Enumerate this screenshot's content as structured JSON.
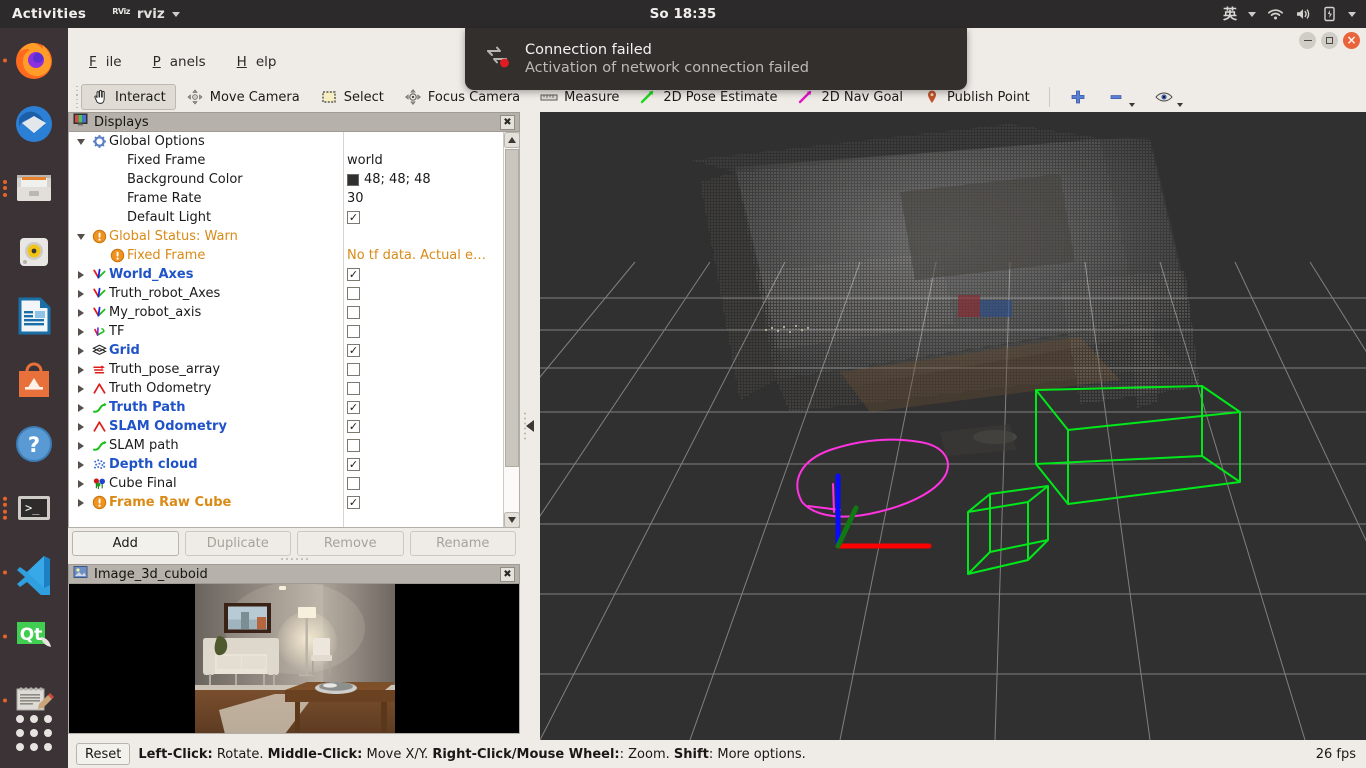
{
  "topbar": {
    "activities": "Activities",
    "app_name": "rviz",
    "app_icon": "rviz-icon",
    "clock": "So 18:35",
    "ime": "英",
    "tray_icons": [
      "wifi-icon",
      "volume-icon",
      "battery-icon"
    ]
  },
  "dock": {
    "items": [
      {
        "name": "firefox",
        "label": "Firefox",
        "running": true
      },
      {
        "name": "thunderbird",
        "label": "Thunderbird",
        "running": false
      },
      {
        "name": "files",
        "label": "Files",
        "running": true
      },
      {
        "name": "rhythmbox",
        "label": "Rhythmbox",
        "running": false
      },
      {
        "name": "libreoffice-impress",
        "label": "LibreOffice Impress",
        "running": false
      },
      {
        "name": "ubuntu-software",
        "label": "Ubuntu Software",
        "running": false
      },
      {
        "name": "help",
        "label": "Help",
        "running": false
      },
      {
        "name": "terminal",
        "label": "Terminal",
        "running": true
      },
      {
        "name": "vscode",
        "label": "Visual Studio Code",
        "running": true
      },
      {
        "name": "qtcreator",
        "label": "Qt Creator",
        "running": true
      },
      {
        "name": "text-editor",
        "label": "Text Editor",
        "running": true
      }
    ],
    "show_apps": "Show Applications"
  },
  "notification": {
    "icon": "network-error-icon",
    "title": "Connection failed",
    "body": "Activation of network connection failed"
  },
  "window": {
    "minimize": "–",
    "maximize": "□",
    "close": "×"
  },
  "menu": [
    {
      "name": "file",
      "pre": "",
      "key": "F",
      "post": "ile"
    },
    {
      "name": "panels",
      "pre": "",
      "key": "P",
      "post": "anels"
    },
    {
      "name": "help",
      "pre": "",
      "key": "H",
      "post": "elp"
    }
  ],
  "toolbar": {
    "items": [
      {
        "name": "interact",
        "label": "Interact",
        "icon": "hand-cursor-icon",
        "active": true
      },
      {
        "name": "move-camera",
        "label": "Move Camera",
        "icon": "move-camera-icon",
        "active": false
      },
      {
        "name": "select",
        "label": "Select",
        "icon": "select-rect-icon",
        "active": false
      },
      {
        "name": "focus-camera",
        "label": "Focus Camera",
        "icon": "focus-camera-icon",
        "active": false
      },
      {
        "name": "measure",
        "label": "Measure",
        "icon": "ruler-icon",
        "active": false
      },
      {
        "name": "pose-estimate",
        "label": "2D Pose Estimate",
        "icon": "green-arrow-icon",
        "active": false
      },
      {
        "name": "nav-goal",
        "label": "2D Nav Goal",
        "icon": "magenta-arrow-icon",
        "active": false
      },
      {
        "name": "publish-point",
        "label": "Publish Point",
        "icon": "map-pin-icon",
        "active": false
      }
    ],
    "add_tool": "+",
    "remove_tool": "–",
    "visibility": "eye"
  },
  "displays_panel": {
    "title": "Displays",
    "icon": "displays-icon",
    "close": "✖",
    "rows": [
      {
        "name": "global-options",
        "label": "Global Options",
        "indent": 0,
        "arrow": "down",
        "icon": "gear-icon",
        "style": "plain",
        "value_type": "none",
        "value": ""
      },
      {
        "name": "fixed-frame",
        "label": "Fixed Frame",
        "indent": 1,
        "arrow": "none",
        "icon": "none",
        "style": "plain",
        "value_type": "text",
        "value": "world"
      },
      {
        "name": "background-color",
        "label": "Background Color",
        "indent": 1,
        "arrow": "none",
        "icon": "none",
        "style": "plain",
        "value_type": "color",
        "value": "48; 48; 48",
        "color": "#303030"
      },
      {
        "name": "frame-rate",
        "label": "Frame Rate",
        "indent": 1,
        "arrow": "none",
        "icon": "none",
        "style": "plain",
        "value_type": "text",
        "value": "30"
      },
      {
        "name": "default-light",
        "label": "Default Light",
        "indent": 1,
        "arrow": "none",
        "icon": "none",
        "style": "plain",
        "value_type": "check",
        "value": "✓"
      },
      {
        "name": "global-status",
        "label": "Global Status: Warn",
        "indent": 0,
        "arrow": "down",
        "icon": "warning-icon",
        "style": "warn",
        "value_type": "none",
        "value": ""
      },
      {
        "name": "status-fixed-frame",
        "label": "Fixed Frame",
        "indent": 1,
        "arrow": "none",
        "icon": "warning-icon",
        "style": "warn",
        "value_type": "text",
        "value": "No tf data.  Actual e…"
      },
      {
        "name": "world-axes",
        "label": "World_Axes",
        "indent": 0,
        "arrow": "right",
        "icon": "axes-icon",
        "style": "enabled",
        "value_type": "check",
        "value": "✓"
      },
      {
        "name": "truth-robot-axes",
        "label": "Truth_robot_Axes",
        "indent": 0,
        "arrow": "right",
        "icon": "axes-icon",
        "style": "plain",
        "value_type": "check",
        "value": ""
      },
      {
        "name": "my-robot-axis",
        "label": "My_robot_axis",
        "indent": 0,
        "arrow": "right",
        "icon": "axes-icon",
        "style": "plain",
        "value_type": "check",
        "value": ""
      },
      {
        "name": "tf",
        "label": "TF",
        "indent": 0,
        "arrow": "right",
        "icon": "tf-icon",
        "style": "plain",
        "value_type": "check",
        "value": ""
      },
      {
        "name": "grid",
        "label": "Grid",
        "indent": 0,
        "arrow": "right",
        "icon": "grid-icon",
        "style": "enabled",
        "value_type": "check",
        "value": "✓"
      },
      {
        "name": "truth-pose-array",
        "label": "Truth_pose_array",
        "indent": 0,
        "arrow": "right",
        "icon": "pose-array-icon",
        "style": "plain",
        "value_type": "check",
        "value": ""
      },
      {
        "name": "truth-odometry",
        "label": "Truth Odometry",
        "indent": 0,
        "arrow": "right",
        "icon": "odometry-icon",
        "style": "plain",
        "value_type": "check",
        "value": ""
      },
      {
        "name": "truth-path",
        "label": "Truth Path",
        "indent": 0,
        "arrow": "right",
        "icon": "path-icon",
        "style": "enabled",
        "value_type": "check",
        "value": "✓"
      },
      {
        "name": "slam-odometry",
        "label": "SLAM Odometry",
        "indent": 0,
        "arrow": "right",
        "icon": "odometry-icon",
        "style": "enabled",
        "value_type": "check",
        "value": "✓"
      },
      {
        "name": "slam-path",
        "label": "SLAM path",
        "indent": 0,
        "arrow": "right",
        "icon": "path-icon",
        "style": "plain",
        "value_type": "check",
        "value": ""
      },
      {
        "name": "depth-cloud",
        "label": "Depth cloud",
        "indent": 0,
        "arrow": "right",
        "icon": "pointcloud-icon",
        "style": "enabled",
        "value_type": "check",
        "value": "✓"
      },
      {
        "name": "cube-final",
        "label": "Cube Final",
        "indent": 0,
        "arrow": "right",
        "icon": "markers-icon",
        "style": "plain",
        "value_type": "check",
        "value": ""
      },
      {
        "name": "frame-raw-cube",
        "label": "Frame Raw Cube",
        "indent": 0,
        "arrow": "right",
        "icon": "warning-icon",
        "style": "warnbold",
        "value_type": "check",
        "value": "✓"
      }
    ],
    "buttons": [
      {
        "name": "add",
        "label": "Add",
        "enabled": true
      },
      {
        "name": "duplicate",
        "label": "Duplicate",
        "enabled": false
      },
      {
        "name": "remove",
        "label": "Remove",
        "enabled": false
      },
      {
        "name": "rename",
        "label": "Rename",
        "enabled": false
      }
    ]
  },
  "image_panel": {
    "title": "Image_3d_cuboid",
    "icon": "image-icon",
    "close": "✖",
    "scene": "rendered living room with sofa, framed picture, floor lamp, chair and coffee table"
  },
  "view3d": {
    "background_color": "#303030",
    "grid_color": "#8c8c8c",
    "axes": {
      "x_color": "#ff0000",
      "y_color": "#00bb00",
      "z_color": "#0000ff"
    },
    "path_color": "#ff33dd",
    "cuboid_color": "#00e81a",
    "contents": "depth point cloud of a room, magenta SLAM path loop, two green wireframe cuboids, origin axes"
  },
  "statusbar": {
    "reset_label": "Reset",
    "hint_parts": [
      {
        "text": "Left-Click:",
        "bold": true
      },
      {
        "text": " Rotate. ",
        "bold": false
      },
      {
        "text": "Middle-Click:",
        "bold": true
      },
      {
        "text": " Move X/Y. ",
        "bold": false
      },
      {
        "text": "Right-Click/Mouse Wheel:",
        "bold": true
      },
      {
        "text": ": Zoom. ",
        "bold": false
      },
      {
        "text": "Shift",
        "bold": true
      },
      {
        "text": ": More options.",
        "bold": false
      }
    ],
    "fps": "26 fps"
  }
}
